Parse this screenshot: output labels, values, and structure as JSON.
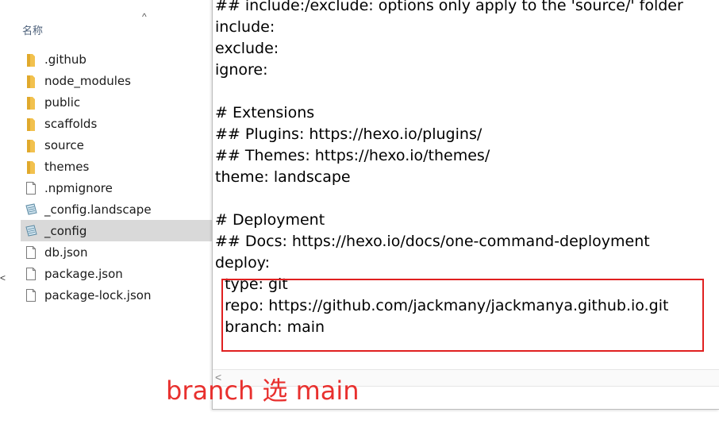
{
  "explorer": {
    "column_header": "名称",
    "edge_chevron": "<",
    "sort_arrow": "^",
    "items": [
      {
        "name": ".github",
        "type": "folder"
      },
      {
        "name": "node_modules",
        "type": "folder"
      },
      {
        "name": "public",
        "type": "folder"
      },
      {
        "name": "scaffolds",
        "type": "folder"
      },
      {
        "name": "source",
        "type": "folder"
      },
      {
        "name": "themes",
        "type": "folder"
      },
      {
        "name": ".npmignore",
        "type": "file"
      },
      {
        "name": "_config.landscape",
        "type": "yml"
      },
      {
        "name": "_config",
        "type": "yml",
        "selected": true
      },
      {
        "name": "db.json",
        "type": "file"
      },
      {
        "name": "package.json",
        "type": "file"
      },
      {
        "name": "package-lock.json",
        "type": "file"
      }
    ]
  },
  "editor": {
    "lines": [
      "## include:/exclude: options only apply to the 'source/' folder",
      "include:",
      "exclude:",
      "ignore:",
      "",
      "# Extensions",
      "## Plugins: https://hexo.io/plugins/",
      "## Themes: https://hexo.io/themes/",
      "theme: landscape",
      "",
      "# Deployment",
      "## Docs: https://hexo.io/docs/one-command-deployment",
      "deploy:",
      "  type: git",
      "  repo: https://github.com/jackmany/jackmanya.github.io.git",
      "  branch: main"
    ],
    "scroll_left": "<"
  },
  "annotation": {
    "text": "branch 选 main",
    "color": "#e8302e"
  },
  "colors": {
    "folder": "#f2c14e",
    "selection": "#d9d9d9",
    "highlight_border": "#e02020"
  }
}
